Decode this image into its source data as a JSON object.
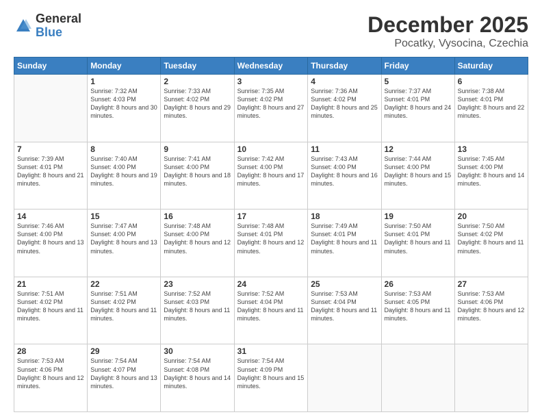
{
  "logo": {
    "general": "General",
    "blue": "Blue"
  },
  "header": {
    "month": "December 2025",
    "location": "Pocatky, Vysocina, Czechia"
  },
  "weekdays": [
    "Sunday",
    "Monday",
    "Tuesday",
    "Wednesday",
    "Thursday",
    "Friday",
    "Saturday"
  ],
  "weeks": [
    [
      {
        "day": "",
        "sunrise": "",
        "sunset": "",
        "daylight": ""
      },
      {
        "day": "1",
        "sunrise": "Sunrise: 7:32 AM",
        "sunset": "Sunset: 4:03 PM",
        "daylight": "Daylight: 8 hours and 30 minutes."
      },
      {
        "day": "2",
        "sunrise": "Sunrise: 7:33 AM",
        "sunset": "Sunset: 4:02 PM",
        "daylight": "Daylight: 8 hours and 29 minutes."
      },
      {
        "day": "3",
        "sunrise": "Sunrise: 7:35 AM",
        "sunset": "Sunset: 4:02 PM",
        "daylight": "Daylight: 8 hours and 27 minutes."
      },
      {
        "day": "4",
        "sunrise": "Sunrise: 7:36 AM",
        "sunset": "Sunset: 4:02 PM",
        "daylight": "Daylight: 8 hours and 25 minutes."
      },
      {
        "day": "5",
        "sunrise": "Sunrise: 7:37 AM",
        "sunset": "Sunset: 4:01 PM",
        "daylight": "Daylight: 8 hours and 24 minutes."
      },
      {
        "day": "6",
        "sunrise": "Sunrise: 7:38 AM",
        "sunset": "Sunset: 4:01 PM",
        "daylight": "Daylight: 8 hours and 22 minutes."
      }
    ],
    [
      {
        "day": "7",
        "sunrise": "Sunrise: 7:39 AM",
        "sunset": "Sunset: 4:01 PM",
        "daylight": "Daylight: 8 hours and 21 minutes."
      },
      {
        "day": "8",
        "sunrise": "Sunrise: 7:40 AM",
        "sunset": "Sunset: 4:00 PM",
        "daylight": "Daylight: 8 hours and 19 minutes."
      },
      {
        "day": "9",
        "sunrise": "Sunrise: 7:41 AM",
        "sunset": "Sunset: 4:00 PM",
        "daylight": "Daylight: 8 hours and 18 minutes."
      },
      {
        "day": "10",
        "sunrise": "Sunrise: 7:42 AM",
        "sunset": "Sunset: 4:00 PM",
        "daylight": "Daylight: 8 hours and 17 minutes."
      },
      {
        "day": "11",
        "sunrise": "Sunrise: 7:43 AM",
        "sunset": "Sunset: 4:00 PM",
        "daylight": "Daylight: 8 hours and 16 minutes."
      },
      {
        "day": "12",
        "sunrise": "Sunrise: 7:44 AM",
        "sunset": "Sunset: 4:00 PM",
        "daylight": "Daylight: 8 hours and 15 minutes."
      },
      {
        "day": "13",
        "sunrise": "Sunrise: 7:45 AM",
        "sunset": "Sunset: 4:00 PM",
        "daylight": "Daylight: 8 hours and 14 minutes."
      }
    ],
    [
      {
        "day": "14",
        "sunrise": "Sunrise: 7:46 AM",
        "sunset": "Sunset: 4:00 PM",
        "daylight": "Daylight: 8 hours and 13 minutes."
      },
      {
        "day": "15",
        "sunrise": "Sunrise: 7:47 AM",
        "sunset": "Sunset: 4:00 PM",
        "daylight": "Daylight: 8 hours and 13 minutes."
      },
      {
        "day": "16",
        "sunrise": "Sunrise: 7:48 AM",
        "sunset": "Sunset: 4:00 PM",
        "daylight": "Daylight: 8 hours and 12 minutes."
      },
      {
        "day": "17",
        "sunrise": "Sunrise: 7:48 AM",
        "sunset": "Sunset: 4:01 PM",
        "daylight": "Daylight: 8 hours and 12 minutes."
      },
      {
        "day": "18",
        "sunrise": "Sunrise: 7:49 AM",
        "sunset": "Sunset: 4:01 PM",
        "daylight": "Daylight: 8 hours and 11 minutes."
      },
      {
        "day": "19",
        "sunrise": "Sunrise: 7:50 AM",
        "sunset": "Sunset: 4:01 PM",
        "daylight": "Daylight: 8 hours and 11 minutes."
      },
      {
        "day": "20",
        "sunrise": "Sunrise: 7:50 AM",
        "sunset": "Sunset: 4:02 PM",
        "daylight": "Daylight: 8 hours and 11 minutes."
      }
    ],
    [
      {
        "day": "21",
        "sunrise": "Sunrise: 7:51 AM",
        "sunset": "Sunset: 4:02 PM",
        "daylight": "Daylight: 8 hours and 11 minutes."
      },
      {
        "day": "22",
        "sunrise": "Sunrise: 7:51 AM",
        "sunset": "Sunset: 4:02 PM",
        "daylight": "Daylight: 8 hours and 11 minutes."
      },
      {
        "day": "23",
        "sunrise": "Sunrise: 7:52 AM",
        "sunset": "Sunset: 4:03 PM",
        "daylight": "Daylight: 8 hours and 11 minutes."
      },
      {
        "day": "24",
        "sunrise": "Sunrise: 7:52 AM",
        "sunset": "Sunset: 4:04 PM",
        "daylight": "Daylight: 8 hours and 11 minutes."
      },
      {
        "day": "25",
        "sunrise": "Sunrise: 7:53 AM",
        "sunset": "Sunset: 4:04 PM",
        "daylight": "Daylight: 8 hours and 11 minutes."
      },
      {
        "day": "26",
        "sunrise": "Sunrise: 7:53 AM",
        "sunset": "Sunset: 4:05 PM",
        "daylight": "Daylight: 8 hours and 11 minutes."
      },
      {
        "day": "27",
        "sunrise": "Sunrise: 7:53 AM",
        "sunset": "Sunset: 4:06 PM",
        "daylight": "Daylight: 8 hours and 12 minutes."
      }
    ],
    [
      {
        "day": "28",
        "sunrise": "Sunrise: 7:53 AM",
        "sunset": "Sunset: 4:06 PM",
        "daylight": "Daylight: 8 hours and 12 minutes."
      },
      {
        "day": "29",
        "sunrise": "Sunrise: 7:54 AM",
        "sunset": "Sunset: 4:07 PM",
        "daylight": "Daylight: 8 hours and 13 minutes."
      },
      {
        "day": "30",
        "sunrise": "Sunrise: 7:54 AM",
        "sunset": "Sunset: 4:08 PM",
        "daylight": "Daylight: 8 hours and 14 minutes."
      },
      {
        "day": "31",
        "sunrise": "Sunrise: 7:54 AM",
        "sunset": "Sunset: 4:09 PM",
        "daylight": "Daylight: 8 hours and 15 minutes."
      },
      {
        "day": "",
        "sunrise": "",
        "sunset": "",
        "daylight": ""
      },
      {
        "day": "",
        "sunrise": "",
        "sunset": "",
        "daylight": ""
      },
      {
        "day": "",
        "sunrise": "",
        "sunset": "",
        "daylight": ""
      }
    ]
  ]
}
